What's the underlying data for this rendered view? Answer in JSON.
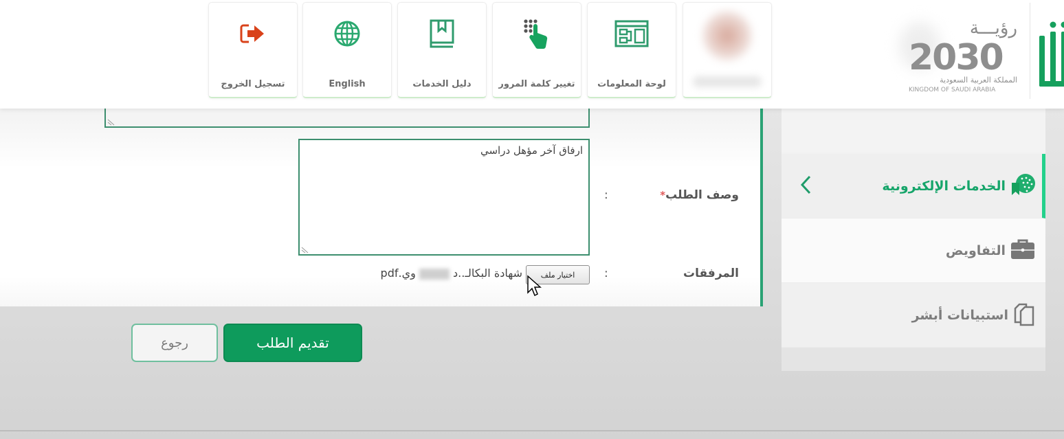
{
  "header": {
    "tiles": [
      {
        "label": "تسجيل الخروج",
        "icon": "logout-icon",
        "icon_color": "#d9421a"
      },
      {
        "label": "English",
        "icon": "globe-icon",
        "icon_color": "#2aa86f"
      },
      {
        "label": "دليل الخدمات",
        "icon": "book-icon",
        "icon_color": "#2f9b6d"
      },
      {
        "label": "تغيير كلمة المرور",
        "icon": "keypad-touch-icon",
        "icon_color": "#17a35f"
      },
      {
        "label": "لوحة المعلومات",
        "icon": "dashboard-icon",
        "icon_color": "#2f9b6d"
      },
      {
        "label": "",
        "icon": "user-avatar",
        "blurred": true
      }
    ],
    "vision": {
      "top": "رؤيـــة",
      "year": "2030",
      "kingdom_ar": "المملكة العربية السعودية",
      "kingdom_en": "KINGDOM OF SAUDI ARABIA"
    },
    "brand_color": "#16a05d"
  },
  "sidebar": {
    "items": [
      {
        "label": "الخدمات الإلكترونية",
        "icon": "e-services-globe-icon",
        "active": true
      },
      {
        "label": "التفاويض",
        "icon": "briefcase-icon",
        "active": false
      },
      {
        "label": "استبيانات أبشر",
        "icon": "documents-icon",
        "active": false
      }
    ],
    "active_color": "#23d18b"
  },
  "form": {
    "description": {
      "label": "وصف الطلب",
      "required_mark": "*",
      "colon": ":",
      "value": "ارفاق آخر مؤهل دراسي"
    },
    "attachments": {
      "label": "المرفقات",
      "colon": ":",
      "choose_file_label": "اختيار ملف",
      "file_name_start": "شهادة البكالـ..د",
      "file_name_end": "وي.pdf"
    }
  },
  "actions": {
    "submit_label": "تقديم الطلب",
    "back_label": "رجوع",
    "submit_color": "#0e9b5c"
  }
}
